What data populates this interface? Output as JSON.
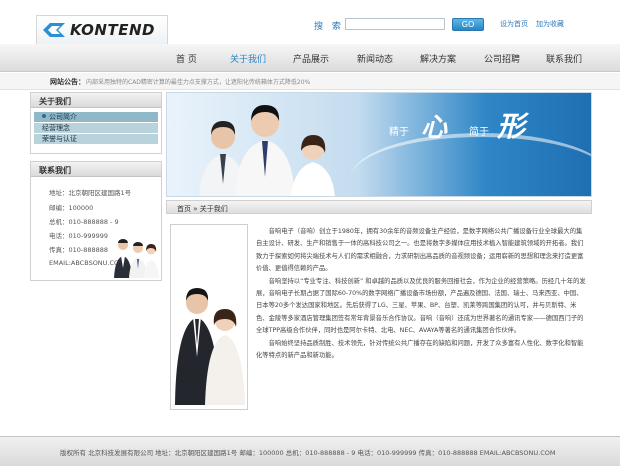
{
  "header": {
    "logo_text": "KONTEND",
    "search_label": "搜 索",
    "search_value": "",
    "go_label": "GO",
    "links": [
      "设为首页",
      "加为收藏"
    ]
  },
  "nav": [
    "首 页",
    "关于我们",
    "产品展示",
    "新闻动态",
    "解决方案",
    "公司招聘",
    "联系我们"
  ],
  "nav_active": "关于我们",
  "notice": {
    "label": "网站公告：",
    "text": "内部采用独特的CAD精密计算的最佳力点支撑方式，让遮阳化传统箱体方式降低20%"
  },
  "sidebar": {
    "about_title": "关于我们",
    "about_items": [
      "公司简介",
      "经营理念",
      "荣誉与认证"
    ],
    "contact_title": "联系我们",
    "contact_lines": [
      "地址：北京朝阳区建国路1号",
      "邮编：100000",
      "总机：010-888888 - 9",
      "电话：010-999999",
      "传真：010-888888",
      "EMAIL:ABCBSONU.COM"
    ]
  },
  "banner": {
    "t1": "精于",
    "b1": "心",
    "t2": "简于",
    "b2": "形"
  },
  "breadcrumb": {
    "home": "首页",
    "sep": " » ",
    "current": "关于我们"
  },
  "article": [
    "音响电子（音响）创立于1980年，拥有30余年的音频设备生产经验，是数字网络公共广播设备行业全球最大的集自主设计、研发、生产和销售于一体的高科技公司之一。也是将数字多媒体应用技术植入智能建筑领域的开拓者。我们致力于探索如何将尖端技术与人们的需求相融合，力求研制出高品质的音视频设备；运用崭新的思想和理念来打造更富价值、更值得信赖的产品。",
    "音响坚持以“专业专注、科技创新” 和卓越的品质以及优良的服务回报社会，作为企业的经营策略。历经几十年的发展，音响电子长期占据了国际60-70%的数字网络广播设备市场份额，产品遍及德国、法国、瑞士、马来西亚、中国、日本等20多个发达国家和地区。先后获得了LG、三星、苹果、BP、台塑、凯莱等跨国集团的认可，并与贝斯特、米色、金陵等多家酒店管理集团签有常年背景音乐合作协议。音响（音响）还成为世界著名的通讯专家——德国西门子的全球TPP高级合作伙伴，同时也是阿尔卡特、北电、NEC、AVAYA等著名的通讯集团合作伙伴。",
    "音响始终坚持品质制胜、技术领先，针对传统公共广播存在的缺陷和问题，开发了众多富有人性化、数字化和智能化等特点的新产品和新功能。"
  ],
  "footer": "版权所有  北京科技发展有限公司  地址：北京朝阳区建国路1号  邮编：100000     总机：010-888888 - 9  电话：010-999999  传真：010-888888  EMAIL:ABCBSONU.COM"
}
